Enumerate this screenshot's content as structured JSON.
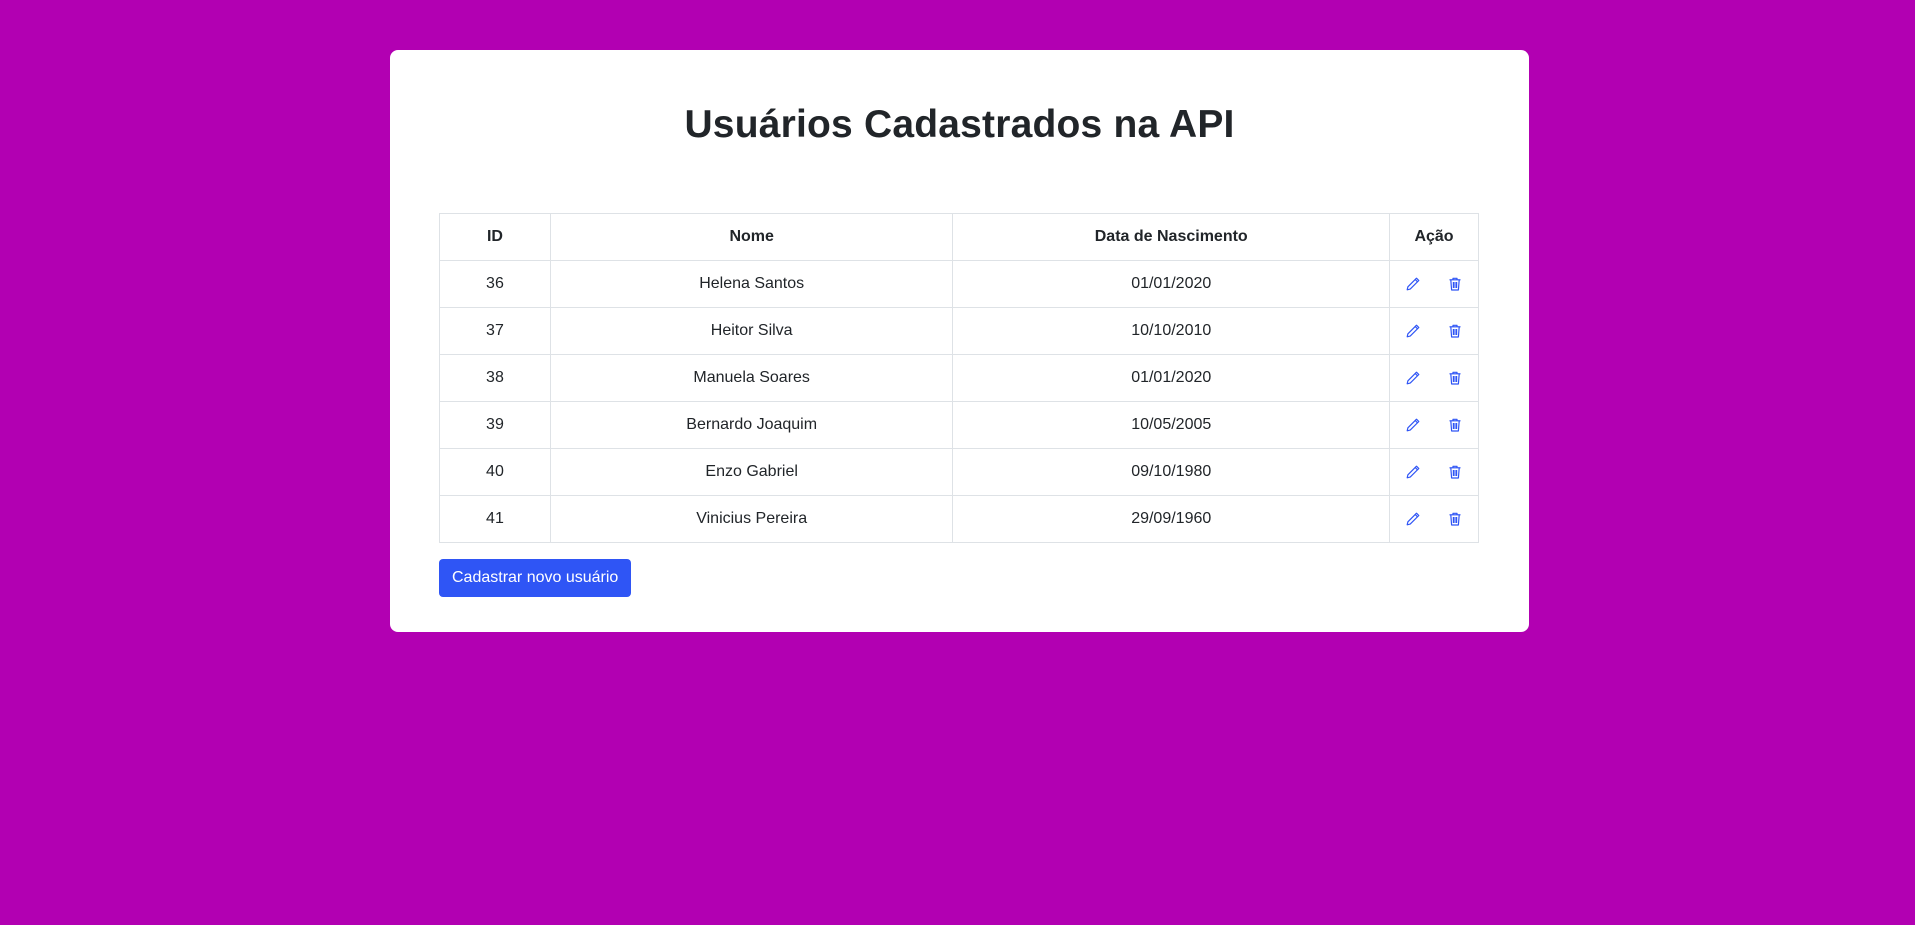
{
  "page": {
    "title": "Usuários Cadastrados na API",
    "background_color": "#b200b2",
    "accent_color": "#2f55f5"
  },
  "table": {
    "headers": {
      "id": "ID",
      "nome": "Nome",
      "data": "Data de Nascimento",
      "acao": "Ação"
    },
    "rows": [
      {
        "id": "36",
        "nome": "Helena Santos",
        "data": "01/01/2020"
      },
      {
        "id": "37",
        "nome": "Heitor Silva",
        "data": "10/10/2010"
      },
      {
        "id": "38",
        "nome": "Manuela Soares",
        "data": "01/01/2020"
      },
      {
        "id": "39",
        "nome": "Bernardo Joaquim",
        "data": "10/05/2005"
      },
      {
        "id": "40",
        "nome": "Enzo Gabriel",
        "data": "09/10/1980"
      },
      {
        "id": "41",
        "nome": "Vinicius Pereira",
        "data": "29/09/1960"
      }
    ],
    "action_icons": [
      "pencil-icon",
      "trash-icon"
    ]
  },
  "actions": {
    "new_user_label": "Cadastrar novo usuário"
  }
}
